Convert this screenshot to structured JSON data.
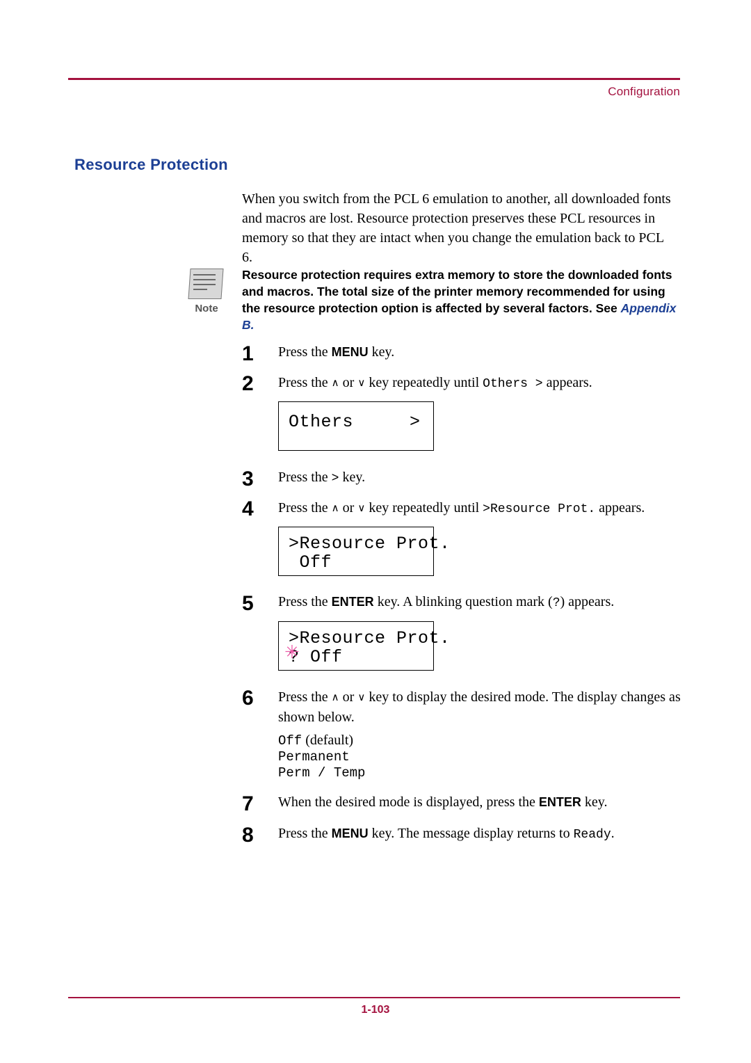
{
  "header": {
    "title": "Configuration"
  },
  "footer": {
    "page_number": "1-103"
  },
  "section": {
    "title": "Resource Protection",
    "intro": "When you switch from the PCL 6 emulation to another, all downloaded fonts and macros are lost. Resource protection preserves these PCL resources in memory so that they are intact when you change the emulation back to PCL 6."
  },
  "note": {
    "label": "Note",
    "text": "Resource protection requires extra memory to store the downloaded fonts and macros. The total size of the printer memory recommended for using the resource protection option is affected by several factors. See ",
    "reference": "Appendix B."
  },
  "steps": [
    {
      "number": "1",
      "parts": [
        "Press the ",
        "MENU",
        " key."
      ]
    },
    {
      "number": "2",
      "parts": [
        "Press the ",
        "∧",
        " or ",
        "∨",
        " key repeatedly until ",
        "Others  >",
        " appears."
      ]
    },
    {
      "number": "3",
      "parts": [
        "Press the ",
        ">",
        " key."
      ]
    },
    {
      "number": "4",
      "parts": [
        "Press the ",
        "∧",
        " or ",
        "∨",
        " key repeatedly until ",
        ">Resource Prot.",
        " appears."
      ]
    },
    {
      "number": "5",
      "parts": [
        "Press the ",
        "ENTER",
        " key. A blinking question mark (",
        "?",
        ") appears."
      ]
    },
    {
      "number": "6",
      "parts": [
        "Press the ",
        "∧",
        " or ",
        "∨",
        " key to display the desired mode. The display changes as shown below."
      ]
    },
    {
      "number": "7",
      "parts": [
        "When the desired mode is displayed, press the ",
        "ENTER",
        " key."
      ]
    },
    {
      "number": "8",
      "parts": [
        "Press the ",
        "MENU",
        " key. The message display returns to ",
        "Ready",
        "."
      ]
    }
  ],
  "displays": [
    {
      "name": "others-display",
      "line1": "Others",
      "line1_right": ">",
      "line2": ""
    },
    {
      "name": "resource-prot-off-display",
      "line1": ">Resource Prot.",
      "line2": " Off"
    },
    {
      "name": "resource-prot-blinking-display",
      "line1": ">Resource Prot.",
      "line2": "? Off"
    }
  ],
  "options": {
    "items": [
      "Off",
      "Permanent",
      "Perm / Temp"
    ],
    "default_marker": "(default)"
  }
}
